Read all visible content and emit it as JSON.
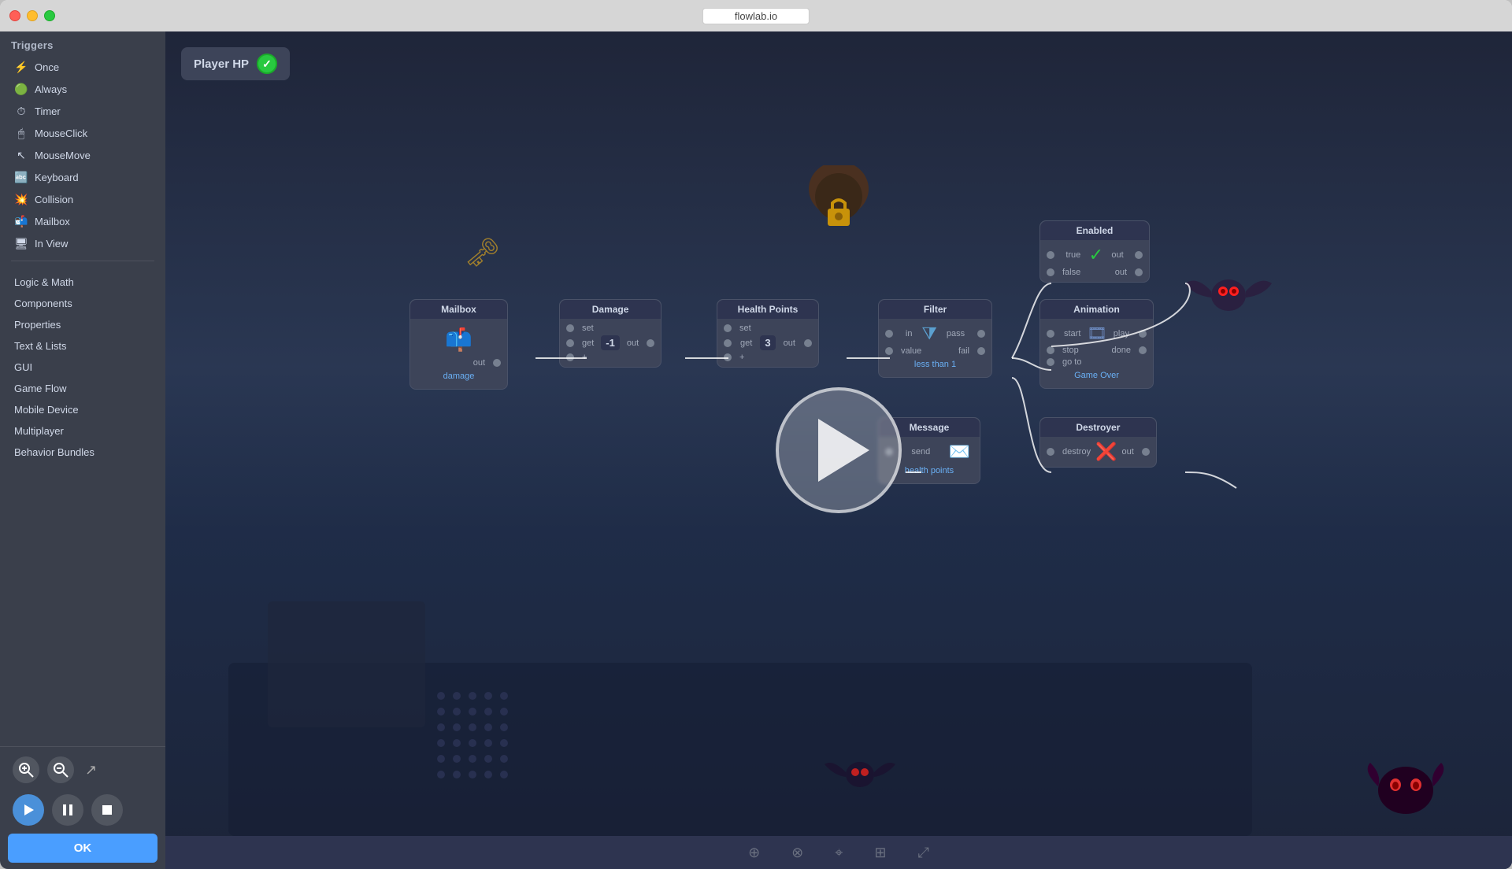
{
  "window": {
    "title": "flowlab.io"
  },
  "titlebar": {
    "traffic_lights": [
      "red",
      "yellow",
      "green"
    ]
  },
  "sidebar": {
    "triggers_section": "Triggers",
    "trigger_items": [
      {
        "label": "Once",
        "icon": "⚡"
      },
      {
        "label": "Always",
        "icon": "🟢"
      },
      {
        "label": "Timer",
        "icon": "⏱"
      },
      {
        "label": "MouseClick",
        "icon": "🖱"
      },
      {
        "label": "MouseMove",
        "icon": "↖"
      },
      {
        "label": "Keyboard",
        "icon": "🔤"
      },
      {
        "label": "Collision",
        "icon": "💥"
      },
      {
        "label": "Mailbox",
        "icon": "📬"
      },
      {
        "label": "In View",
        "icon": "🖥"
      }
    ],
    "category_items": [
      {
        "label": "Logic & Math"
      },
      {
        "label": "Components"
      },
      {
        "label": "Properties"
      },
      {
        "label": "Text & Lists"
      },
      {
        "label": "GUI"
      },
      {
        "label": "Game Flow"
      },
      {
        "label": "Mobile Device"
      },
      {
        "label": "Multiplayer"
      },
      {
        "label": "Behavior Bundles"
      }
    ],
    "zoom_in_label": "+",
    "zoom_out_label": "−",
    "ok_label": "OK"
  },
  "canvas": {
    "player_hp_label": "Player HP",
    "nodes": {
      "mailbox": {
        "title": "Mailbox",
        "out_label": "out",
        "sub_label": "damage"
      },
      "damage": {
        "title": "Damage",
        "rows": [
          "set",
          "get",
          "+"
        ],
        "out_label": "out",
        "value": "-1"
      },
      "healthpoints": {
        "title": "Health Points",
        "rows": [
          "set",
          "get",
          "+"
        ],
        "out_label": "out",
        "value": "3"
      },
      "filter": {
        "title": "Filter",
        "in_label": "in",
        "value_label": "value",
        "pass_label": "pass",
        "fail_label": "fail",
        "sub_label": "less than 1"
      },
      "enabled": {
        "title": "Enabled",
        "true_label": "true",
        "false_label": "false",
        "out_label": "out"
      },
      "animation": {
        "title": "Animation",
        "rows": [
          "start",
          "stop",
          "go to"
        ],
        "play_label": "play",
        "done_label": "done",
        "sub_label": "Game Over"
      },
      "message": {
        "title": "Message",
        "send_label": "send",
        "sub_label": "health points"
      },
      "destroyer": {
        "title": "Destroyer",
        "destroy_label": "destroy",
        "out_label": "out"
      }
    }
  },
  "playback": {
    "play_label": "▶",
    "pause_label": "⏸",
    "stop_label": "⏹"
  },
  "colors": {
    "accent_blue": "#4a9eff",
    "node_bg": "#3d4459",
    "node_header": "#2e3450",
    "canvas_bg": "#2a3142",
    "sidebar_bg": "#3a3f4b",
    "ok_btn": "#4a9eff"
  }
}
